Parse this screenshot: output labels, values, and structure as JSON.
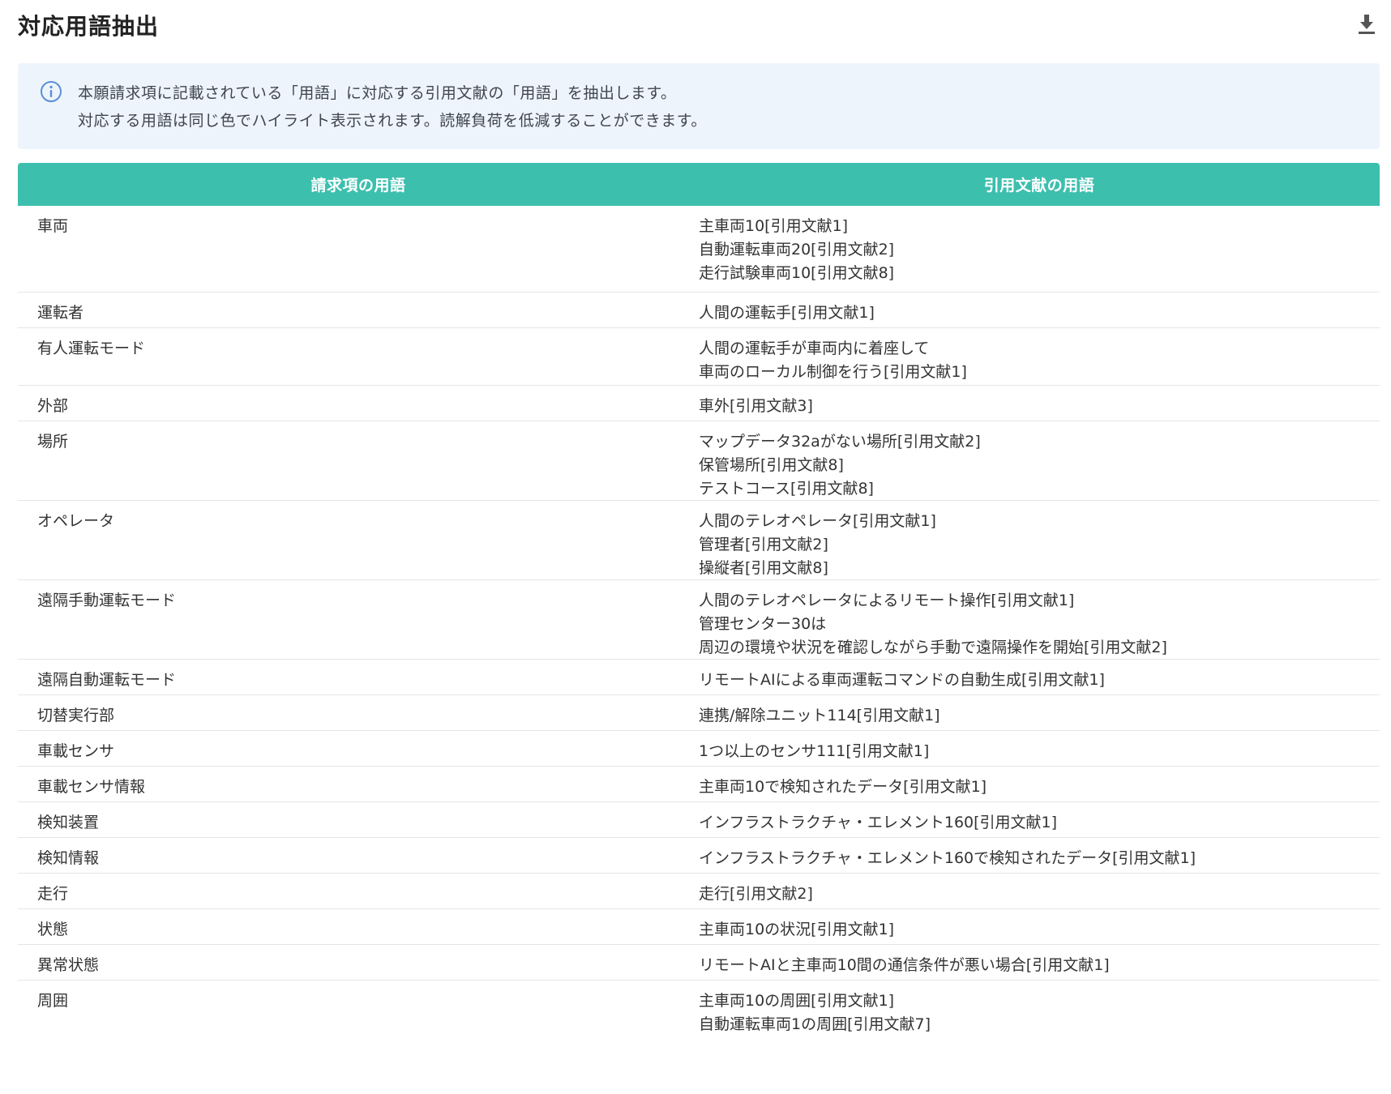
{
  "header": {
    "title": "対応用語抽出",
    "download_icon": "download-icon"
  },
  "info": {
    "icon": "info-circle-icon",
    "line1": "本願請求項に記載されている「用語」に対応する引用文献の「用語」を抽出します。",
    "line2": "対応する用語は同じ色でハイライト表示されます。読解負荷を低減することができます。"
  },
  "table": {
    "headers": [
      "請求項の用語",
      "引用文献の用語"
    ],
    "rows": [
      {
        "claim": "車両",
        "cited": [
          "主車両10[引用文献1]",
          "自動運転車両20[引用文献2]",
          "走行試験車両10[引用文献8]"
        ]
      },
      {
        "claim": "運転者",
        "cited": [
          "人間の運転手[引用文献1]"
        ]
      },
      {
        "claim": "有人運転モード",
        "cited": [
          "人間の運転手が車両内に着座して",
          "車両のローカル制御を行う[引用文献1]"
        ]
      },
      {
        "claim": "外部",
        "cited": [
          "車外[引用文献3]"
        ]
      },
      {
        "claim": "場所",
        "cited": [
          "マップデータ32aがない場所[引用文献2]",
          "保管場所[引用文献8]",
          "テストコース[引用文献8]"
        ]
      },
      {
        "claim": "オペレータ",
        "cited": [
          "人間のテレオペレータ[引用文献1]",
          "管理者[引用文献2]",
          "操縦者[引用文献8]"
        ]
      },
      {
        "claim": "遠隔手動運転モード",
        "cited": [
          "人間のテレオペレータによるリモート操作[引用文献1]",
          "管理センター30は",
          "周辺の環境や状況を確認しながら手動で遠隔操作を開始[引用文献2]"
        ]
      },
      {
        "claim": "遠隔自動運転モード",
        "cited": [
          "リモートAIによる車両運転コマンドの自動生成[引用文献1]"
        ]
      },
      {
        "claim": "切替実行部",
        "cited": [
          "連携/解除ユニット114[引用文献1]"
        ]
      },
      {
        "claim": "車載センサ",
        "cited": [
          "1つ以上のセンサ111[引用文献1]"
        ]
      },
      {
        "claim": "車載センサ情報",
        "cited": [
          "主車両10で検知されたデータ[引用文献1]"
        ]
      },
      {
        "claim": "検知装置",
        "cited": [
          "インフラストラクチャ・エレメント160[引用文献1]"
        ]
      },
      {
        "claim": "検知情報",
        "cited": [
          "インフラストラクチャ・エレメント160で検知されたデータ[引用文献1]"
        ]
      },
      {
        "claim": "走行",
        "cited": [
          "走行[引用文献2]"
        ]
      },
      {
        "claim": "状態",
        "cited": [
          "主車両10の状況[引用文献1]"
        ]
      },
      {
        "claim": "異常状態",
        "cited": [
          "リモートAIと主車両10間の通信条件が悪い場合[引用文献1]"
        ]
      },
      {
        "claim": "周囲",
        "cited": [
          "主車両10の周囲[引用文献1]",
          "自動運転車両1の周囲[引用文献7]"
        ]
      }
    ]
  },
  "colors": {
    "header_bg": "#3dbfae",
    "info_bg": "#eef4fb",
    "info_icon": "#5b8fd9"
  }
}
